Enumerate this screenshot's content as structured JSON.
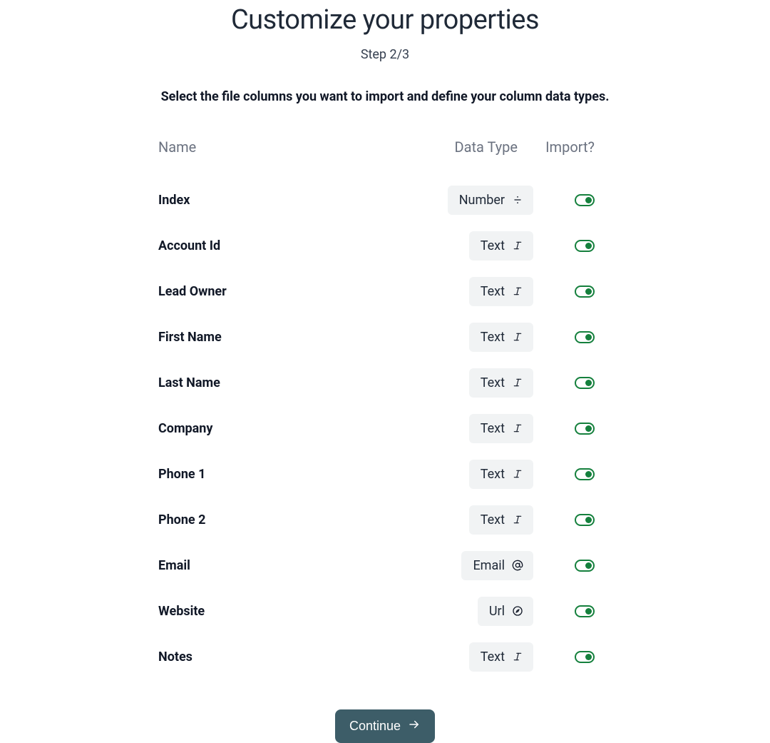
{
  "header": {
    "title": "Customize your properties",
    "step": "Step 2/3",
    "instruction": "Select the file columns you want to import and define your column data types."
  },
  "columns": {
    "name": "Name",
    "dataType": "Data Type",
    "import": "Import?"
  },
  "rows": [
    {
      "name": "Index",
      "dataType": "Number",
      "icon": "number",
      "importOn": true
    },
    {
      "name": "Account Id",
      "dataType": "Text",
      "icon": "text",
      "importOn": true
    },
    {
      "name": "Lead Owner",
      "dataType": "Text",
      "icon": "text",
      "importOn": true
    },
    {
      "name": "First Name",
      "dataType": "Text",
      "icon": "text",
      "importOn": true
    },
    {
      "name": "Last Name",
      "dataType": "Text",
      "icon": "text",
      "importOn": true
    },
    {
      "name": "Company",
      "dataType": "Text",
      "icon": "text",
      "importOn": true
    },
    {
      "name": "Phone 1",
      "dataType": "Text",
      "icon": "text",
      "importOn": true
    },
    {
      "name": "Phone 2",
      "dataType": "Text",
      "icon": "text",
      "importOn": true
    },
    {
      "name": "Email",
      "dataType": "Email",
      "icon": "email",
      "importOn": true
    },
    {
      "name": "Website",
      "dataType": "Url",
      "icon": "url",
      "importOn": true
    },
    {
      "name": "Notes",
      "dataType": "Text",
      "icon": "text",
      "importOn": true
    }
  ],
  "footer": {
    "continueLabel": "Continue"
  }
}
